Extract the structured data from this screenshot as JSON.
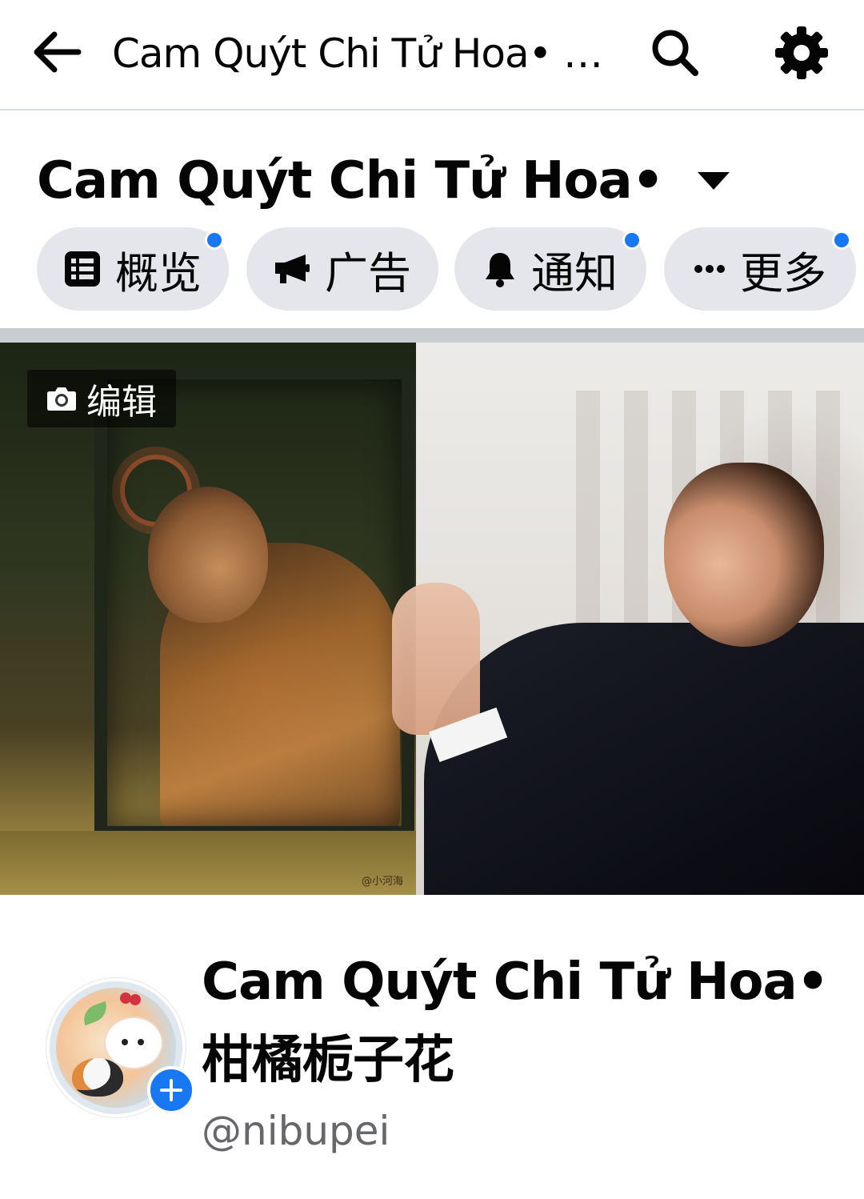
{
  "topbar": {
    "title": "Cam Quýt Chi Tử Hoa• 柑...",
    "back_icon": "arrow-left-icon",
    "search_icon": "search-icon",
    "settings_icon": "gear-icon"
  },
  "header": {
    "page_name": "Cam Quýt Chi Tử Hoa•...",
    "switch_icon": "caret-down-icon"
  },
  "tabs": [
    {
      "label": "概览",
      "icon": "list-icon",
      "has_notification": true
    },
    {
      "label": "广告",
      "icon": "megaphone-icon",
      "has_notification": false
    },
    {
      "label": "通知",
      "icon": "bell-icon",
      "has_notification": true
    },
    {
      "label": "更多",
      "icon": "more-icon",
      "has_notification": true
    }
  ],
  "cover": {
    "edit_label": "编辑",
    "edit_icon": "camera-icon",
    "watermark": "@小河海"
  },
  "profile": {
    "name_line1": "Cam Quýt Chi Tử Hoa•",
    "name_line2": "柑橘栀子花",
    "username": "@nibupei",
    "add_icon": "plus-icon"
  },
  "colors": {
    "accent": "#1877f2",
    "pill_bg": "#e4e6eb",
    "secondary_text": "#65676b",
    "divider": "#c9ccd1"
  }
}
